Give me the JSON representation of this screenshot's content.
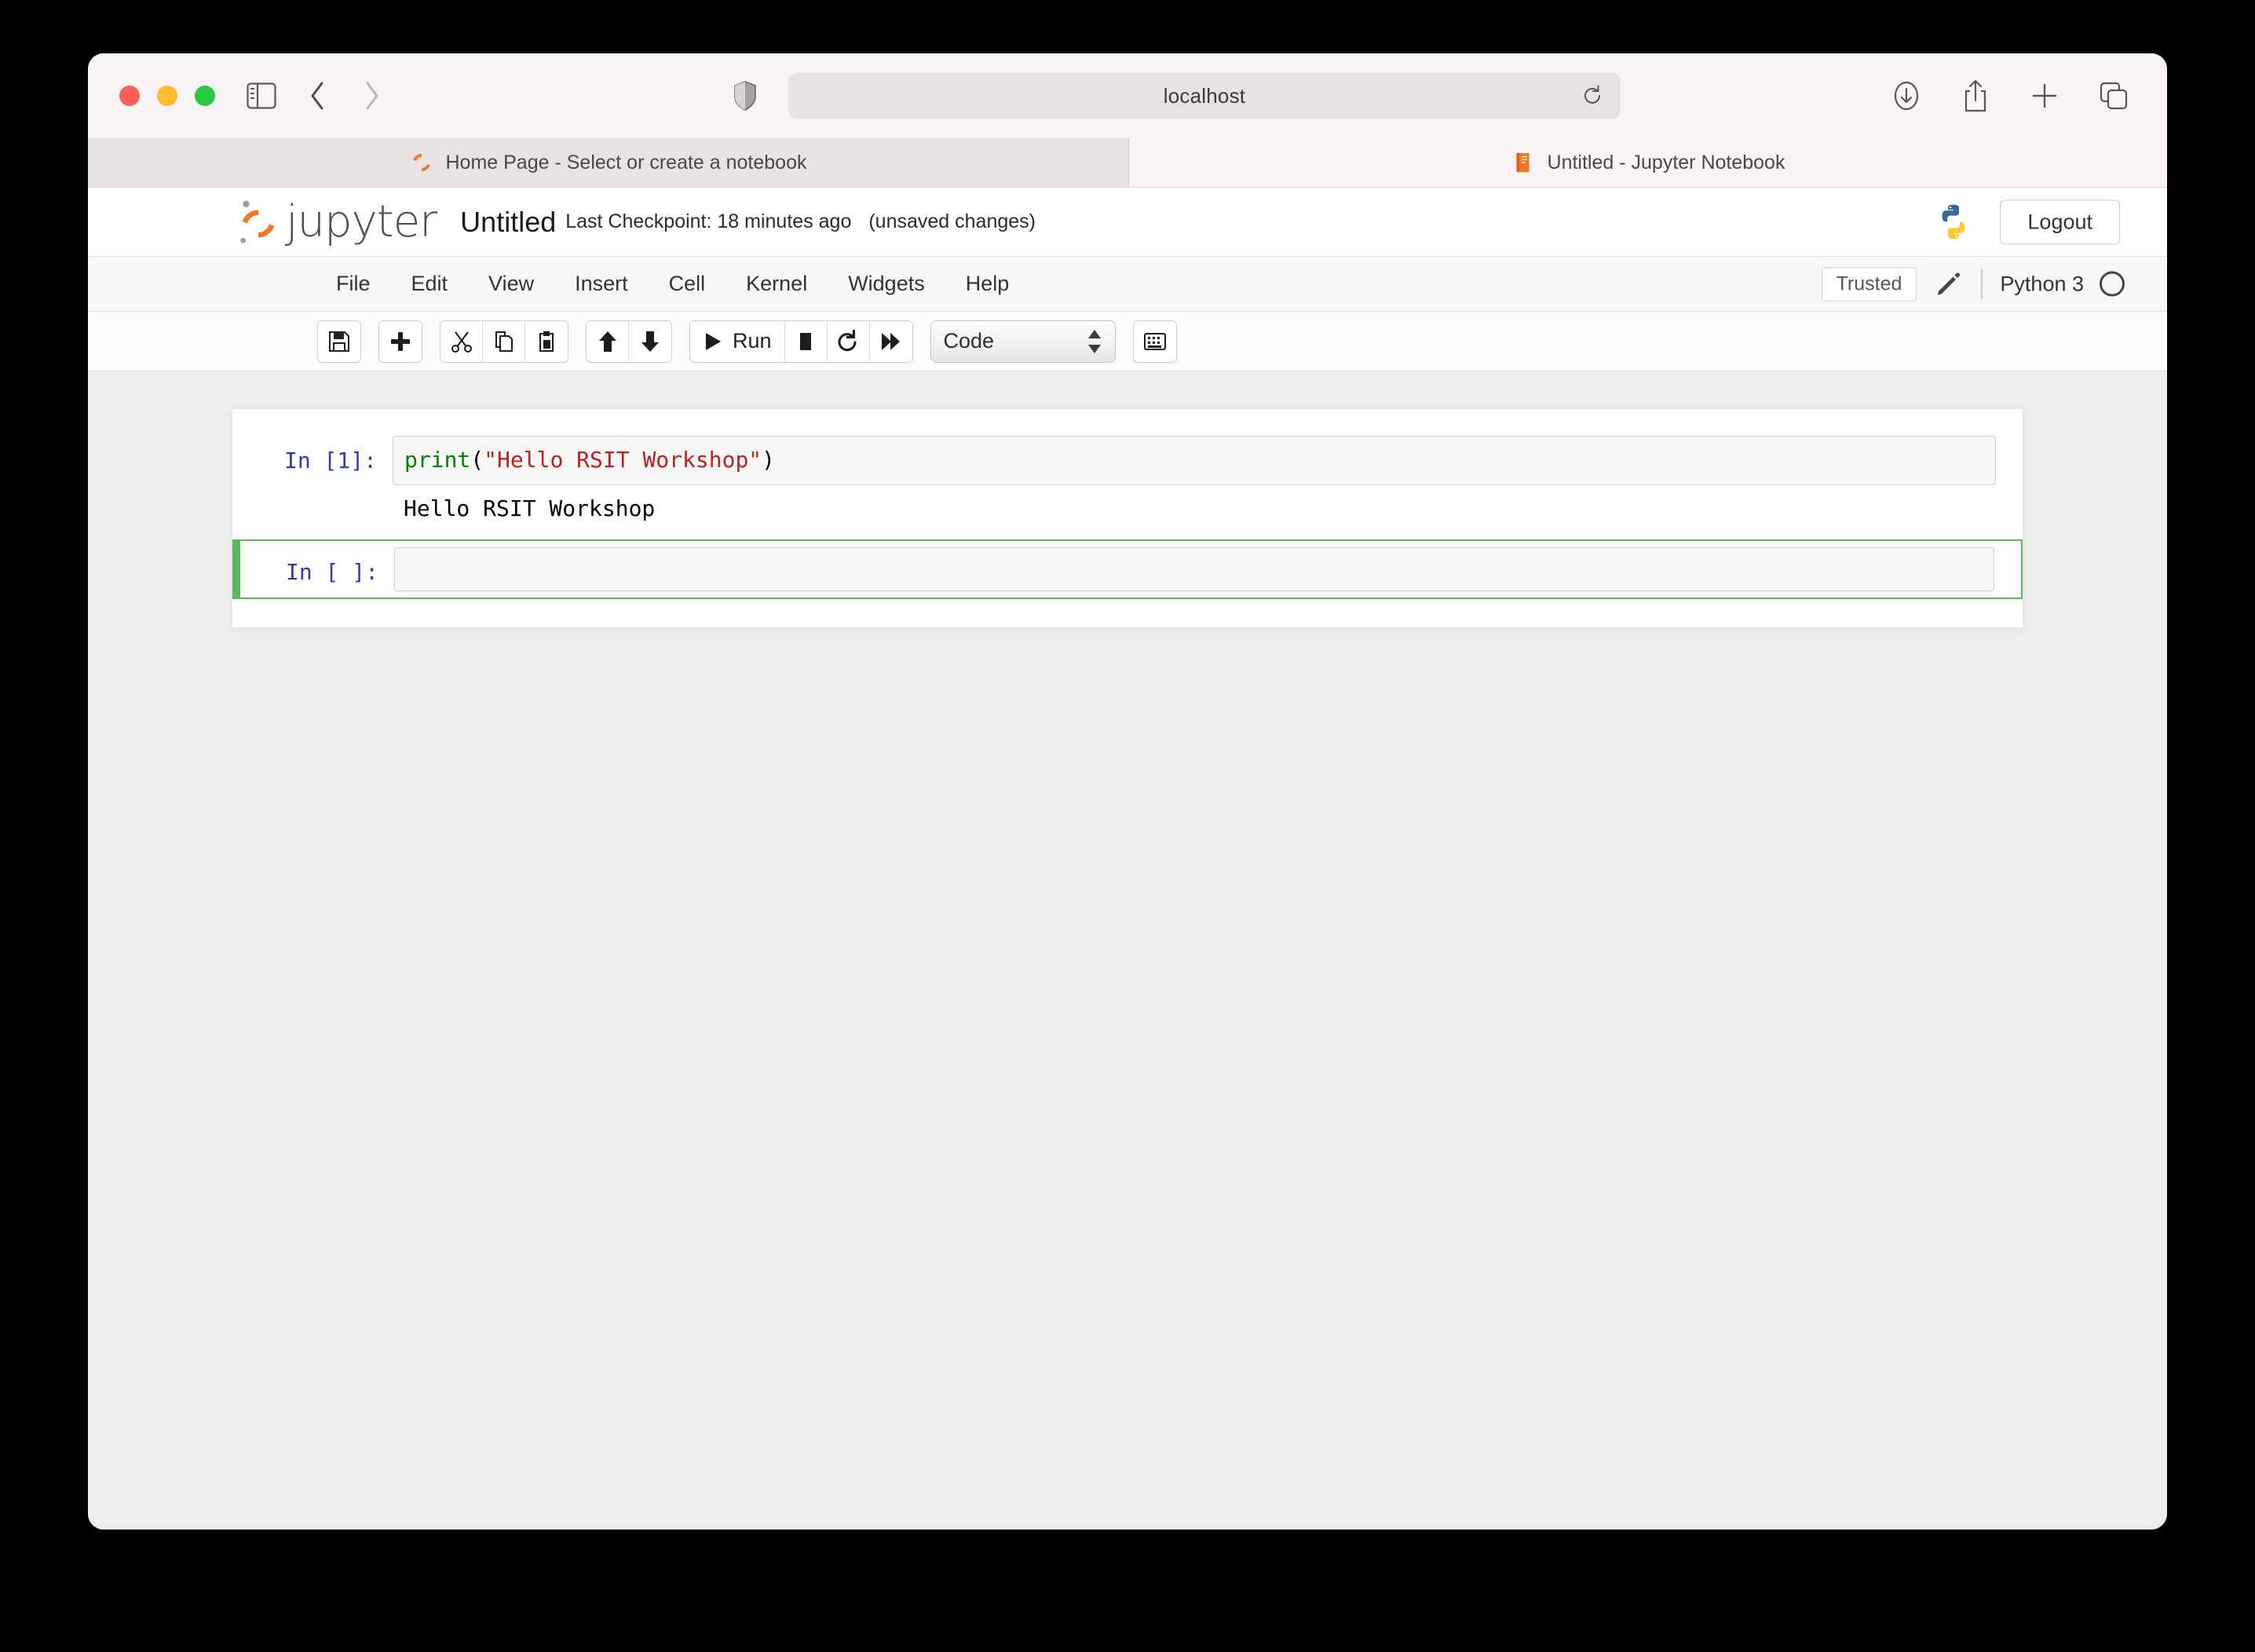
{
  "browser": {
    "address": "localhost",
    "traffic_lights": [
      "close",
      "minimize",
      "maximize"
    ],
    "tabs": [
      {
        "title": "Home Page - Select or create a notebook",
        "favicon": "jupyter-spinner-icon",
        "active": false
      },
      {
        "title": "Untitled - Jupyter Notebook",
        "favicon": "orange-notebook-icon",
        "active": true
      }
    ],
    "toolbar_icons": [
      "sidebar-icon",
      "back-icon",
      "forward-icon",
      "shield-icon",
      "reload-icon",
      "downloads-icon",
      "share-icon",
      "new-tab-icon",
      "tab-overview-icon"
    ]
  },
  "jupyter": {
    "wordmark": "jupyter",
    "notebook_title": "Untitled",
    "checkpoint": "Last Checkpoint: 18 minutes ago",
    "unsaved": "(unsaved changes)",
    "logout_label": "Logout",
    "menu": [
      {
        "label": "File"
      },
      {
        "label": "Edit"
      },
      {
        "label": "View"
      },
      {
        "label": "Insert"
      },
      {
        "label": "Cell"
      },
      {
        "label": "Kernel"
      },
      {
        "label": "Widgets"
      },
      {
        "label": "Help"
      }
    ],
    "trusted_label": "Trusted",
    "kernel_name": "Python 3",
    "kernel_status": "idle",
    "toolbar": {
      "save_title": "Save and Checkpoint",
      "insert_title": "Insert cell below",
      "cut_title": "Cut selected cells",
      "copy_title": "Copy selected cells",
      "paste_title": "Paste cells below",
      "move_up_title": "Move selected cells up",
      "move_down_title": "Move selected cells down",
      "run_label": "Run",
      "stop_title": "Interrupt the kernel",
      "restart_title": "Restart the kernel",
      "restart_run_all_title": "Restart the kernel and re-run the notebook",
      "cell_type": "Code",
      "command_palette_title": "Open the command palette"
    }
  },
  "notebook": {
    "cells": [
      {
        "prompt": "In [1]:",
        "type": "code",
        "selected": false,
        "source_tokens": [
          {
            "text": "print",
            "kind": "builtin"
          },
          {
            "text": "(",
            "kind": "plain"
          },
          {
            "text": "\"Hello RSIT Workshop\"",
            "kind": "string"
          },
          {
            "text": ")",
            "kind": "plain"
          }
        ],
        "output": "Hello RSIT Workshop"
      },
      {
        "prompt": "In [ ]:",
        "type": "code",
        "selected": true,
        "source_tokens": [],
        "output": null
      }
    ]
  },
  "colors": {
    "jupyter_orange": "#F37726",
    "prompt_blue": "#303F9F",
    "selected_green": "#5cb85c",
    "string_red": "#BA2121",
    "builtin_green": "#008000",
    "chrome_bg": "#faf3f3",
    "page_bg": "#ededed"
  }
}
